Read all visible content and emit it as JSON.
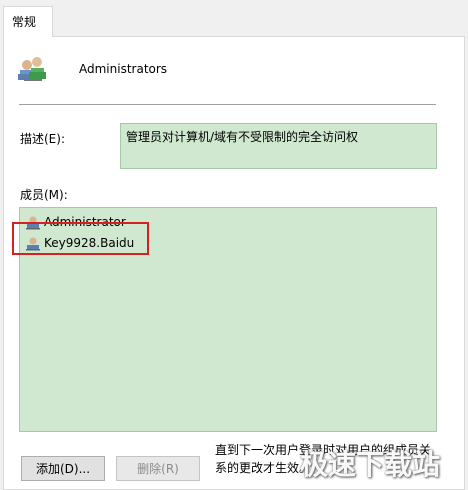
{
  "tab": {
    "label": "常规"
  },
  "group": {
    "name": "Administrators",
    "icon": "users-group-icon"
  },
  "description": {
    "label": "描述(E):",
    "value": "管理员对计算机/域有不受限制的完全访问权"
  },
  "members": {
    "label": "成员(M):",
    "items": [
      {
        "name": "Administrator",
        "icon": "user-icon"
      },
      {
        "name": "Key9928.Baidu",
        "icon": "user-icon"
      }
    ]
  },
  "buttons": {
    "add": "添加(D)...",
    "remove": "删除(R)"
  },
  "note": "直直到下一次用户登录时对用户的组成员关系的更改才生效",
  "note_lines": [
    "直到下一次用户登录时对用户的组成员关",
    "系的更改才生效。"
  ],
  "watermark": "极速下载站",
  "colors": {
    "field_bg": "#cfe8cf",
    "highlight": "#d42222"
  }
}
